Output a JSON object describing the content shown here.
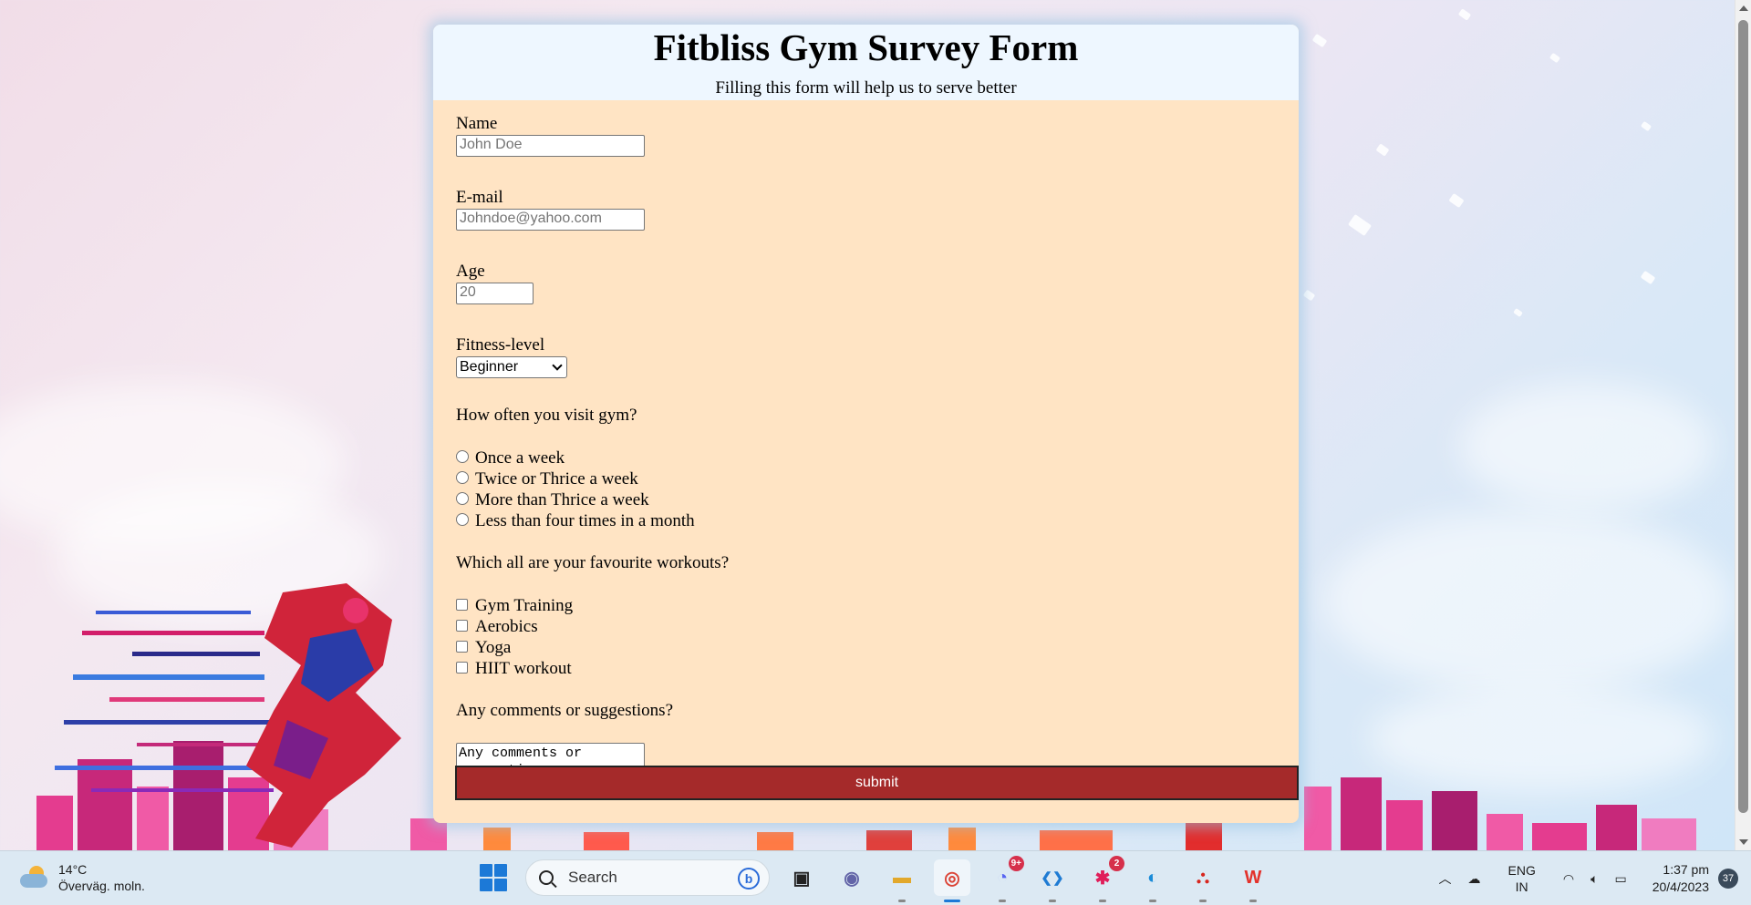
{
  "survey": {
    "title": "Fitbliss Gym Survey Form",
    "description": "Filling this form will help us to serve better",
    "name": {
      "label": "Name",
      "placeholder": "John Doe"
    },
    "email": {
      "label": "E-mail",
      "placeholder": "Johndoe@yahoo.com"
    },
    "age": {
      "label": "Age",
      "placeholder": "20"
    },
    "fitness": {
      "label": "Fitness-level",
      "selected": "Beginner"
    },
    "visit": {
      "question": "How often you visit gym?",
      "options": [
        "Once a week",
        "Twice or Thrice a week",
        "More than Thrice a week",
        "Less than four times in a month"
      ]
    },
    "workouts": {
      "question": "Which all are your favourite workouts?",
      "options": [
        "Gym Training",
        "Aerobics",
        "Yoga",
        "HIIT workout"
      ]
    },
    "comments": {
      "question": "Any comments or suggestions?",
      "placeholder": "Any comments or suggestions..."
    },
    "submit_label": "submit"
  },
  "taskbar": {
    "weather": {
      "temp": "14°C",
      "condition": "Överväg. moln."
    },
    "search_label": "Search",
    "bing_label": "b",
    "apps": [
      {
        "name": "task-view-icon",
        "glyph": "▣",
        "color": "#222222"
      },
      {
        "name": "teams-icon",
        "glyph": "◉",
        "color": "#6264a7"
      },
      {
        "name": "file-explorer-icon",
        "glyph": "▬",
        "color": "#e2a82b"
      },
      {
        "name": "chrome-icon",
        "glyph": "◎",
        "color": "#db4437"
      },
      {
        "name": "discord-icon",
        "glyph": "◔",
        "color": "#5865f2",
        "badge": "9+"
      },
      {
        "name": "vscode-icon",
        "glyph": "❮❯",
        "color": "#1f7bd3"
      },
      {
        "name": "slack-icon",
        "glyph": "✱",
        "color": "#e01e5a",
        "badge": "2"
      },
      {
        "name": "edge-icon",
        "glyph": "◐",
        "color": "#1a8bd8"
      },
      {
        "name": "acrobat-icon",
        "glyph": "⛬",
        "color": "#d7261e"
      },
      {
        "name": "wps-icon",
        "glyph": "W",
        "color": "#e3322b"
      }
    ],
    "lang_top": "ENG",
    "lang_bottom": "IN",
    "time": "1:37 pm",
    "date": "20/4/2023",
    "notifications": "37"
  }
}
